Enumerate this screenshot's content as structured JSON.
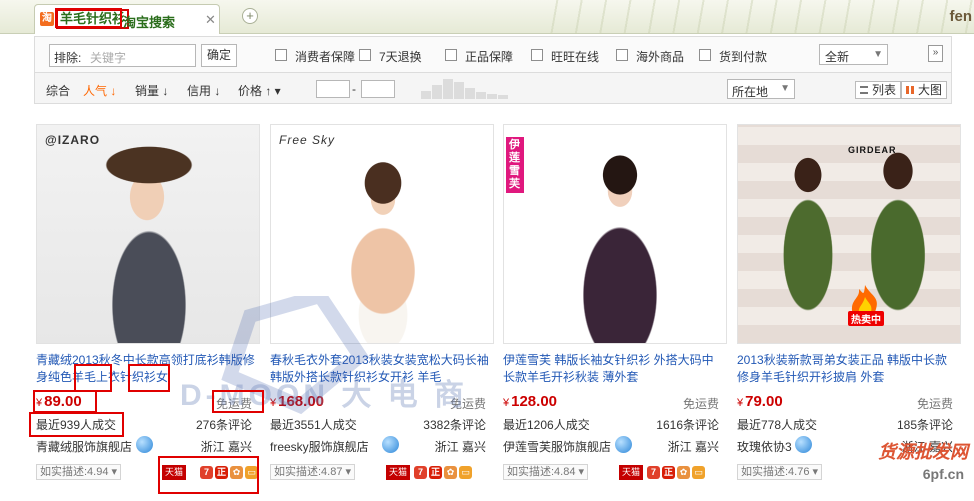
{
  "tabbar": {
    "tab_badge": "淘",
    "keyword": "羊毛针织衫",
    "tab_title": "淘宝搜索",
    "close": "✕",
    "new_tab": "+",
    "corner_text": "fen"
  },
  "filter": {
    "exclude_label": "排除:",
    "exclude_placeholder": "关键字",
    "confirm": "确定",
    "checkboxes": [
      "消费者保障",
      "7天退换",
      "正品保障",
      "旺旺在线",
      "海外商品",
      "货到付款"
    ],
    "sort_select": "全新",
    "expand": "»"
  },
  "sortbar": {
    "items": [
      "综合",
      "人气",
      "销量",
      "信用",
      "价格"
    ],
    "active": "人气",
    "price_dash": "-",
    "location": "所在地",
    "view_list": "列表",
    "view_grid": "大图"
  },
  "products": [
    {
      "brand": "@IZARO",
      "title": "青藏绒2013秋冬中长款高领打底衫韩版修身纯色羊毛上衣针织衫女",
      "price": "89.00",
      "currency": "¥",
      "shipping": "免运费",
      "sold": "最近939人成交",
      "comments": "276条评论",
      "shop": "青藏绒服饰旗舰店",
      "region": "浙江 嘉兴",
      "rating": "如实描述:4.94"
    },
    {
      "brand": "Free Sky",
      "title": "春秋毛衣外套2013秋装女装宽松大码长袖韩版外搭长款针织衫女开衫 羊毛",
      "price": "168.00",
      "currency": "¥",
      "shipping": "免运费",
      "sold": "最近3551人成交",
      "comments": "3382条评论",
      "shop": "freesky服饰旗舰店",
      "region": "浙江 嘉兴",
      "rating": "如实描述:4.87"
    },
    {
      "brand": "伊莲雪芙",
      "title": "伊莲雪芙 韩版长袖女针织衫 外搭大码中长款羊毛开衫秋装 薄外套",
      "price": "128.00",
      "currency": "¥",
      "shipping": "免运费",
      "sold": "最近1206人成交",
      "comments": "1616条评论",
      "shop": "伊莲雪芙服饰旗舰店",
      "region": "浙江 嘉兴",
      "rating": "如实描述:4.84"
    },
    {
      "brand": "GIRDEAR",
      "title": "2013秋装新款哥弟女装正品 韩版中长款修身羊毛针织开衫披肩 外套",
      "price": "79.00",
      "currency": "¥",
      "shipping": "免运费",
      "sold": "最近778人成交",
      "comments": "185条评论",
      "shop": "玫瑰依协3",
      "region": "浙江 嘉兴",
      "rating": "如实描述:4.76",
      "hot_label": "热卖中"
    }
  ],
  "badges": {
    "tmall": "天猫",
    "seven": "7",
    "zheng": "正",
    "leaf": "✿",
    "card": "▭"
  },
  "watermark": {
    "text": "D-MOON 大 电 商",
    "site": "货源批发网",
    "url": "6pf.cn"
  }
}
